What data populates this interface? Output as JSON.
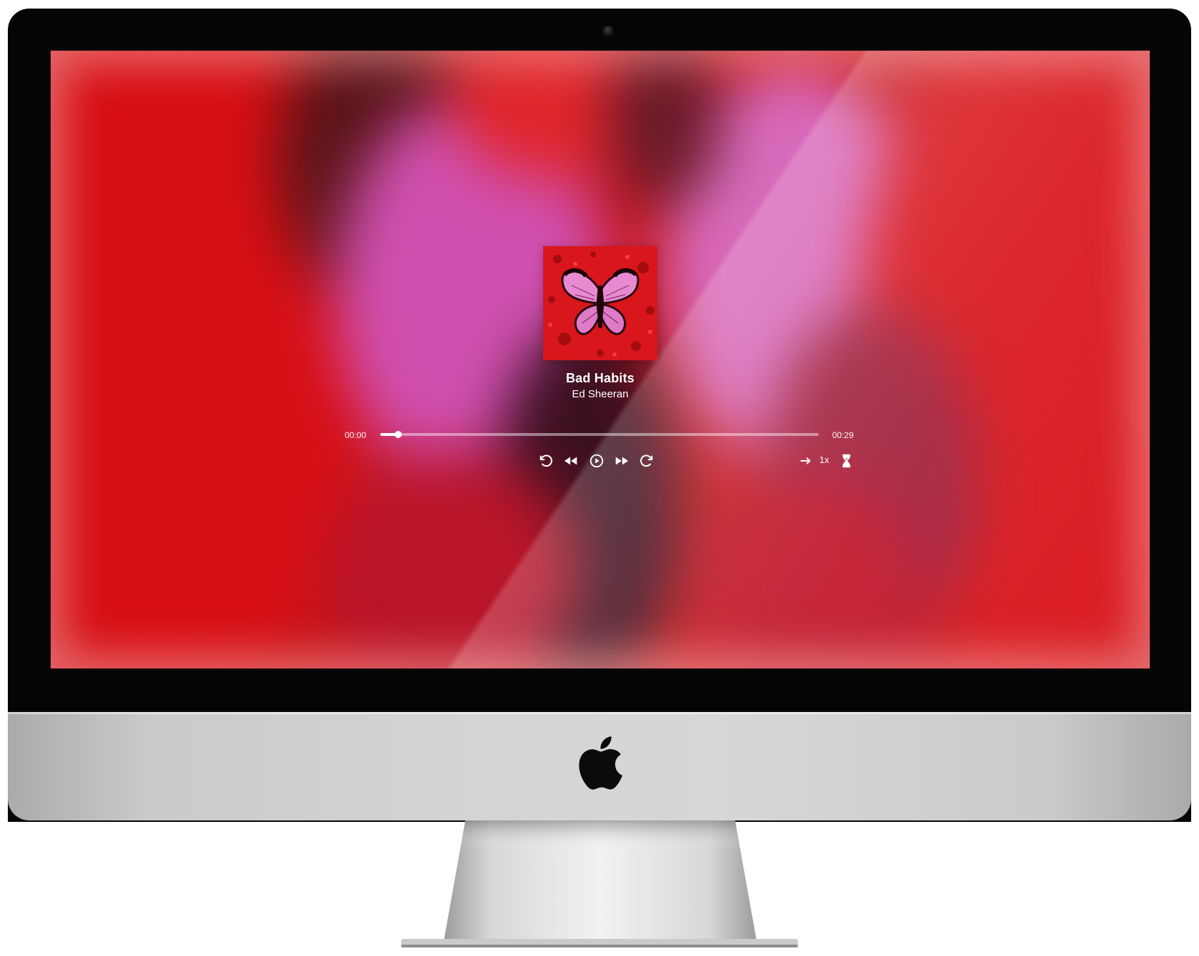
{
  "track": {
    "title": "Bad Habits",
    "artist": "Ed Sheeran"
  },
  "playback": {
    "current_time": "00:00",
    "total_time": "00:29",
    "progress_percent": 4,
    "speed": "1x"
  },
  "controls": {
    "replay_icon": "rotate-ccw-icon",
    "rewind_icon": "rewind-icon",
    "play_icon": "play-circle-icon",
    "forward_icon": "fast-forward-icon",
    "redo_icon": "rotate-cw-icon",
    "repeat_icon": "arrow-right-icon",
    "timer_icon": "hourglass-icon"
  },
  "colors": {
    "accent": "#ffffff",
    "background_red": "#d3141a",
    "background_pink": "#e070c0"
  }
}
